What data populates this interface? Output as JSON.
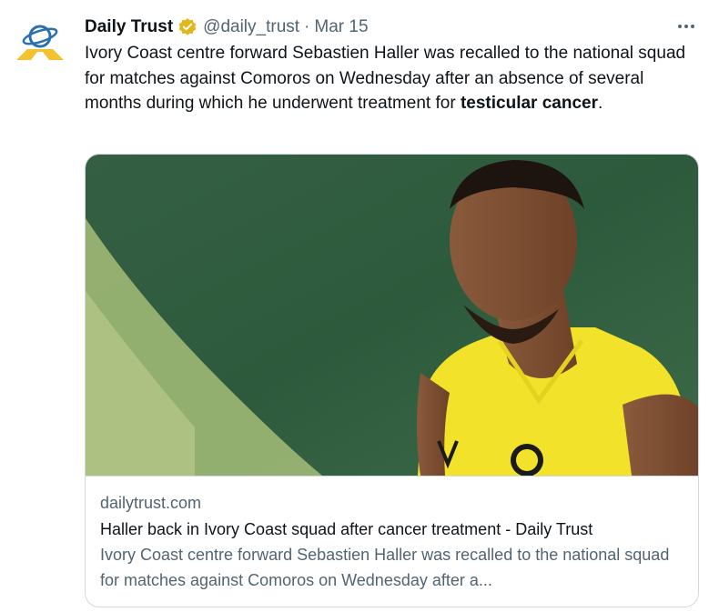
{
  "tweet": {
    "author_name": "Daily Trust",
    "verified_icon": "verified-badge-icon",
    "handle": "@daily_trust",
    "separator": "·",
    "date": "Mar 15",
    "more_icon": "more-options-icon",
    "text_before": "Ivory Coast centre forward Sebastien Haller was recalled to the national squad for matches against Comoros on Wednesday after an absence of several months during which he underwent treatment for ",
    "text_bold": "testicular cancer",
    "text_after": "."
  },
  "card": {
    "domain": "dailytrust.com",
    "title": "Haller back in Ivory Coast squad after cancer treatment - Daily Trust",
    "description": "Ivory Coast centre forward Sebastien Haller was recalled to the national squad for matches against Comoros on Wednesday after a..."
  },
  "colors": {
    "text_primary": "#0f1419",
    "text_secondary": "#536471",
    "border": "#cfd9de",
    "verified_gold": "#e2b719",
    "jersey_yellow": "#f2e22a",
    "background_green": "#2f5a3d"
  }
}
